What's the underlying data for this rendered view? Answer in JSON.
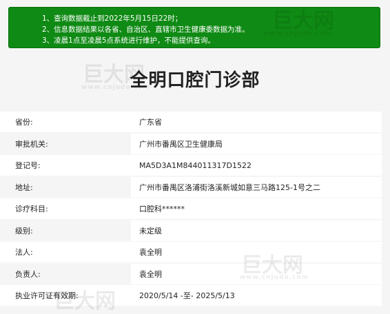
{
  "notice": {
    "lines": [
      "1、查询数据截止到2022年5月15日22时；",
      "2、信息数据结果以各省、自治区、直辖市卫生健康委数据为准。",
      "3、凌晨1点至凌晨5点系统进行维护，不能提供查询。"
    ]
  },
  "page_title": "全明口腔门诊部",
  "fields": [
    {
      "label": "省份:",
      "value": "广东省"
    },
    {
      "label": "审批机关:",
      "value": "广州市番禺区卫生健康局"
    },
    {
      "label": "登记号:",
      "value": "MA5D3A1M844011317D1522"
    },
    {
      "label": "地址:",
      "value": "广州市番禺区洛浦街洛溪新城如意三马路125-1号之二"
    },
    {
      "label": "诊疗科目:",
      "value": "口腔科******"
    },
    {
      "label": "级别:",
      "value": "未定级"
    },
    {
      "label": "法人:",
      "value": "袁全明"
    },
    {
      "label": "负责人:",
      "value": "袁全明"
    },
    {
      "label": "执业许可证有效期:",
      "value": "2020/5/14 -至- 2025/5/13"
    }
  ],
  "watermark": {
    "brand": "巨大网",
    "domain": "www.cnjuda.com"
  }
}
